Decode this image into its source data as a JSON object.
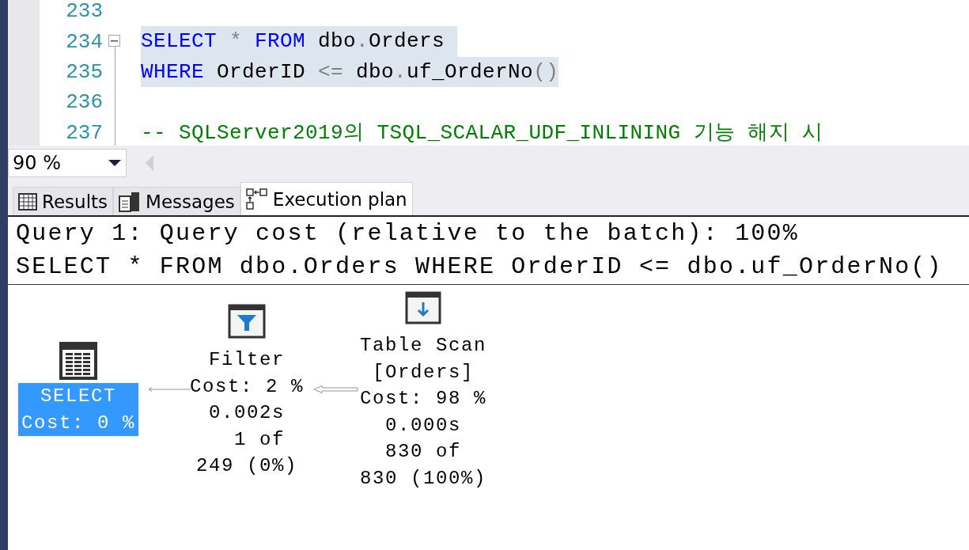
{
  "editor": {
    "lines": [
      {
        "number": "233",
        "highlighted": false,
        "collapsible": false
      },
      {
        "number": "234",
        "highlighted": true,
        "collapsible": true,
        "tokens": [
          {
            "kind": "keyword",
            "text": "SELECT"
          },
          {
            "kind": "operator",
            "text": " * "
          },
          {
            "kind": "keyword",
            "text": "FROM"
          },
          {
            "kind": "plain",
            "text": " dbo"
          },
          {
            "kind": "operator",
            "text": "."
          },
          {
            "kind": "plain",
            "text": "Orders "
          }
        ]
      },
      {
        "number": "235",
        "highlighted": true,
        "collapsible": false,
        "tokens": [
          {
            "kind": "keyword",
            "text": "WHERE"
          },
          {
            "kind": "plain",
            "text": " OrderID "
          },
          {
            "kind": "operator",
            "text": "<="
          },
          {
            "kind": "plain",
            "text": " dbo"
          },
          {
            "kind": "operator",
            "text": "."
          },
          {
            "kind": "plain",
            "text": "uf_OrderNo"
          },
          {
            "kind": "operator",
            "text": "()"
          }
        ]
      },
      {
        "number": "236",
        "highlighted": false,
        "collapsible": false
      },
      {
        "number": "237",
        "highlighted": false,
        "collapsible": false,
        "tokens": [
          {
            "kind": "comment",
            "text": "-- SQLServer2019의 TSQL_SCALAR_UDF_INLINING 기능 해지 시"
          }
        ]
      }
    ]
  },
  "zoom": {
    "value": "90 %"
  },
  "tabs": [
    {
      "label": "Results",
      "kind": "grid",
      "selected": false
    },
    {
      "label": "Messages",
      "kind": "messages",
      "selected": false
    },
    {
      "label": "Execution plan",
      "kind": "plan",
      "selected": true
    }
  ],
  "plan": {
    "header": [
      "Query 1: Query cost (relative to the batch): 100%",
      "SELECT * FROM dbo.Orders WHERE OrderID <= dbo.uf_OrderNo()"
    ],
    "nodes": [
      {
        "kind": "select",
        "selected": true,
        "lines": [
          "SELECT",
          "Cost: 0 %"
        ]
      },
      {
        "kind": "filter",
        "selected": false,
        "lines": [
          "Filter",
          "Cost: 2 %",
          "0.002s",
          "  1 of",
          "249 (0%)"
        ]
      },
      {
        "kind": "table_scan",
        "selected": false,
        "lines": [
          "Table Scan",
          "[Orders]",
          "Cost: 98 %",
          "0.000s",
          "830 of",
          "830 (100%)"
        ]
      }
    ]
  }
}
